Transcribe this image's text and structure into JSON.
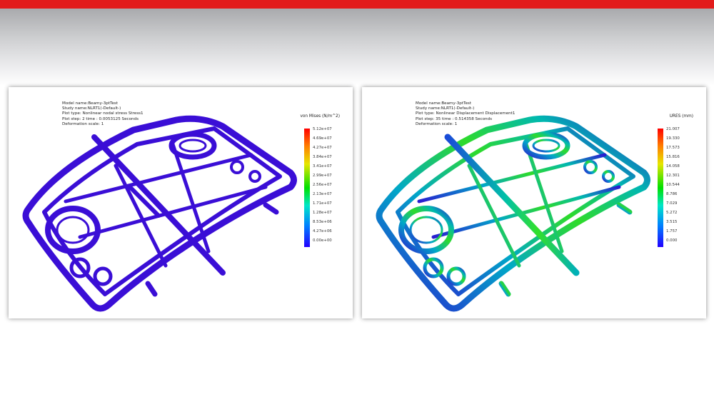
{
  "colors": {
    "accent_red": "#e21b1b",
    "stress_part": "#3a0ed6",
    "displacement_low": "#2a1cd0",
    "displacement_mid": "#00b8b0",
    "displacement_high": "#2edb2a"
  },
  "left_panel": {
    "model_info": [
      "Model name:Beamy-3ptTest",
      "Study name:NLRT1(-Default-)",
      "Plot type: Nonlinear nodal stress Stress1",
      "Plot step: 2   time : 0.0053125 Seconds",
      "Deformation scale: 1"
    ],
    "legend_title": "von Mises (N/m^2)",
    "legend_labels": [
      "5.12e+07",
      "4.69e+07",
      "4.27e+07",
      "3.84e+07",
      "3.41e+07",
      "2.99e+07",
      "2.56e+07",
      "2.13e+07",
      "1.71e+07",
      "1.28e+07",
      "8.53e+06",
      "4.27e+06",
      "0.00e+00"
    ]
  },
  "right_panel": {
    "model_info": [
      "Model name:Beamy-3ptTest",
      "Study name:NLRT1(-Default-)",
      "Plot type: Nonlinear Displacement Displacement1",
      "Plot step: 35   time : 0.514358 Seconds",
      "Deformation scale: 1"
    ],
    "legend_title": "URES (mm)",
    "legend_labels": [
      "21.007",
      "19.330",
      "17.573",
      "15.816",
      "14.058",
      "12.301",
      "10.544",
      "8.786",
      "7.029",
      "5.272",
      "3.515",
      "1.757",
      "0.000"
    ]
  }
}
